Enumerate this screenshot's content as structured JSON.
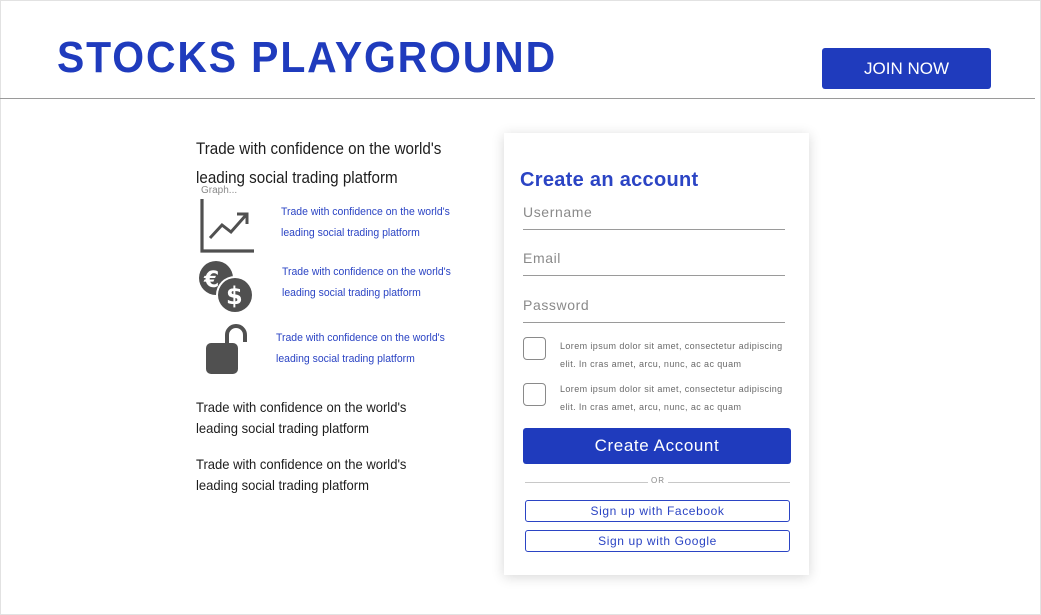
{
  "header": {
    "title": "STOCKS PLAYGROUND",
    "join_label": "JOIN NOW"
  },
  "intro": {
    "headline": "Trade with confidence on the world's leading social trading platform"
  },
  "features": [
    {
      "icon": "chart-trend-icon",
      "caption": "Graph...",
      "text": "Trade with confidence on the world's leading social trading platform"
    },
    {
      "icon": "currency-coins-icon",
      "text": "Trade with confidence on the world's leading social trading platform"
    },
    {
      "icon": "unlocked-padlock-icon",
      "text": "Trade with confidence on the world's leading social trading platform"
    }
  ],
  "paragraphs": [
    "Trade with confidence on the world's leading social trading platform",
    "Trade with confidence on the world's leading social trading platform"
  ],
  "signup": {
    "title": "Create an account",
    "username_placeholder": "Username",
    "email_placeholder": "Email",
    "password_placeholder": "Password",
    "checkbox_1_label": "Lorem ipsum dolor sit amet, consectetur adipiscing elit. In cras amet, arcu, nunc, ac ac quam",
    "checkbox_2_label": "Lorem ipsum dolor sit amet, consectetur adipiscing elit. In cras amet, arcu, nunc, ac ac quam",
    "submit_label": "Create Account",
    "divider_label": "OR",
    "facebook_label": "Sign up with Facebook",
    "google_label": "Sign up with Google"
  },
  "colors": {
    "brand": "#1f3bbd",
    "link_text": "#2b44c4",
    "icon_gray": "#505050"
  }
}
